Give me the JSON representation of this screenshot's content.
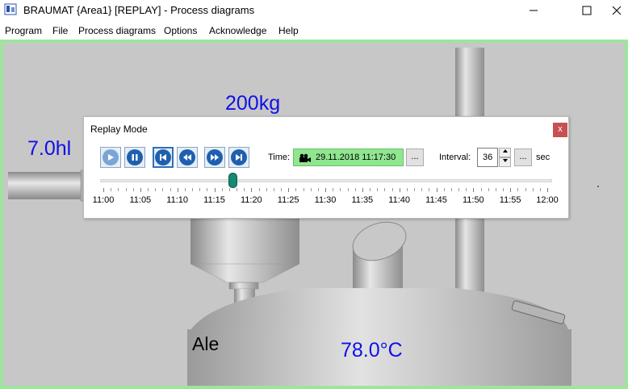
{
  "window": {
    "title": "BRAUMAT {Area1} [REPLAY] - Process diagrams",
    "minimize": "—",
    "maximize": "☐",
    "close": "✕"
  },
  "menu": [
    "Program",
    "File",
    "Process diagrams",
    "Options",
    "Acknowledge",
    "Help"
  ],
  "process": {
    "weight": "200kg",
    "volume": "7.0hl",
    "vessel_name": "Ale",
    "temperature": "78.0°C",
    "border_color": "#9de59d",
    "value_color": "#1010e8"
  },
  "replay": {
    "title": "Replay Mode",
    "close": "x",
    "time_label": "Time:",
    "time_value": "29.11.2018 11:17:30",
    "browse": "...",
    "interval_label": "Interval:",
    "interval_value": "36",
    "interval_unit": "sec",
    "interval_browse": "...",
    "timeline_position": 0.2917,
    "timeline_labels": [
      "11:00",
      "11:05",
      "11:10",
      "11:15",
      "11:20",
      "11:25",
      "11:30",
      "11:35",
      "11:40",
      "11:45",
      "11:50",
      "11:55",
      "12:00"
    ],
    "controls": [
      "play-icon",
      "pause-icon",
      "skip-to-start-icon",
      "rewind-icon",
      "fast-forward-icon",
      "skip-to-end-icon"
    ],
    "time_box_color": "#8fe68f",
    "thumb_color": "#138a72"
  }
}
